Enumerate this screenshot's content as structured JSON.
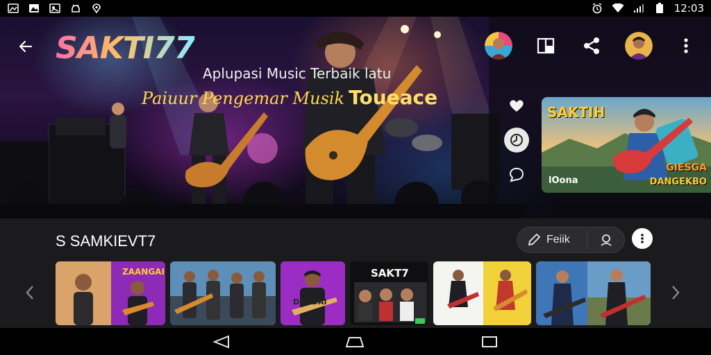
{
  "status_bar": {
    "time": "12:03",
    "left_icons": [
      "gallery-icon",
      "image-icon",
      "photo-icon",
      "android-icon",
      "location-icon"
    ],
    "right_icons": [
      "alarm-icon",
      "wifi-icon",
      "signal-icon",
      "battery-icon"
    ]
  },
  "hero": {
    "brand": "SAKTI77",
    "tagline_line1": "Aplupasi Music Terbaik latu",
    "tagline_line2": "Paiuur Pengemar Musik",
    "tagline_line2_big": "Toueace"
  },
  "feature_card": {
    "title": "SAKTIH",
    "corner_text": "lOona",
    "sub_line1": "GIESGA",
    "sub_line2": "DANGEKBO"
  },
  "section": {
    "title": "S SAMKIEVT7",
    "pill_label": "Feiik"
  },
  "thumbnails": [
    {
      "label": "ZAANGAI"
    },
    {
      "label": ""
    },
    {
      "label": "DANDAI"
    },
    {
      "label": "SAKT7"
    },
    {
      "label": ""
    },
    {
      "label": ""
    }
  ],
  "colors": {
    "accent_yellow": "#ffd84a",
    "background_lower": "#1b1b1e",
    "pill_bg": "#2c2c30"
  }
}
